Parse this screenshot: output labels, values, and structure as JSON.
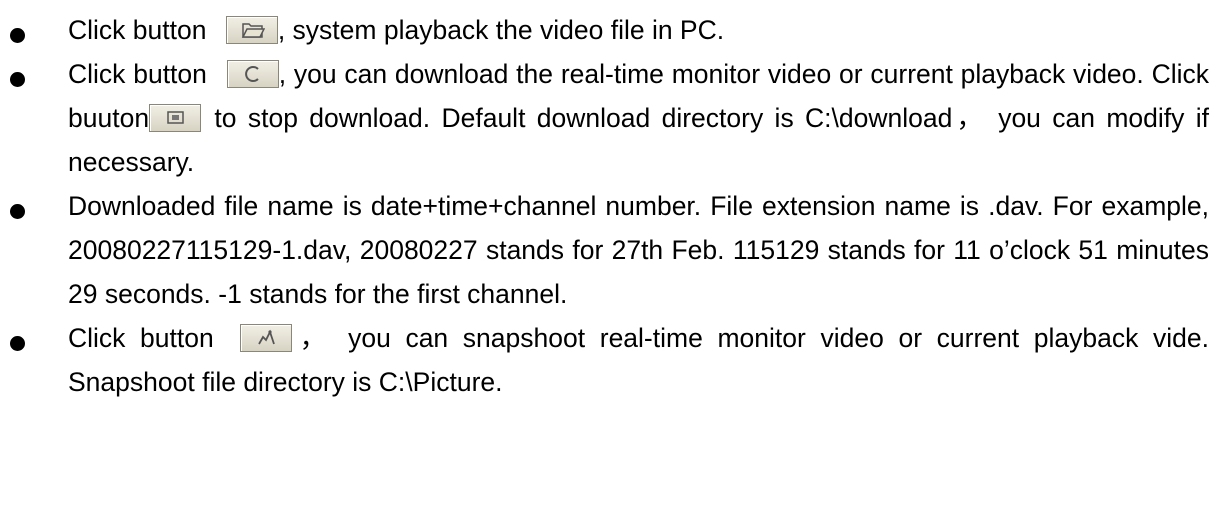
{
  "items": [
    {
      "pre": "Click button ",
      "post": ", system playback the video file in PC."
    },
    {
      "pre": "Click button ",
      "mid": ", you can download the real-time monitor video or current playback video. Click buuton",
      "post": " to stop download. Default download directory is C:\\download， you can modify if necessary."
    },
    {
      "text": "Downloaded file name is date+time+channel number. File extension name is .dav. For example, 20080227115129-1.dav, 20080227 stands for 27th Feb. 115129 stands for 11 o’clock 51 minutes 29 seconds. -1 stands for the first channel."
    },
    {
      "pre": "Click button ",
      "post": "， you can snapshoot real-time monitor video or current playback vide. Snapshoot file directory is C:\\Picture."
    }
  ],
  "icons": {
    "open_file": "folder-icon",
    "download": "download-icon",
    "stop_download": "stop-download-icon",
    "snapshot": "snapshot-icon"
  }
}
